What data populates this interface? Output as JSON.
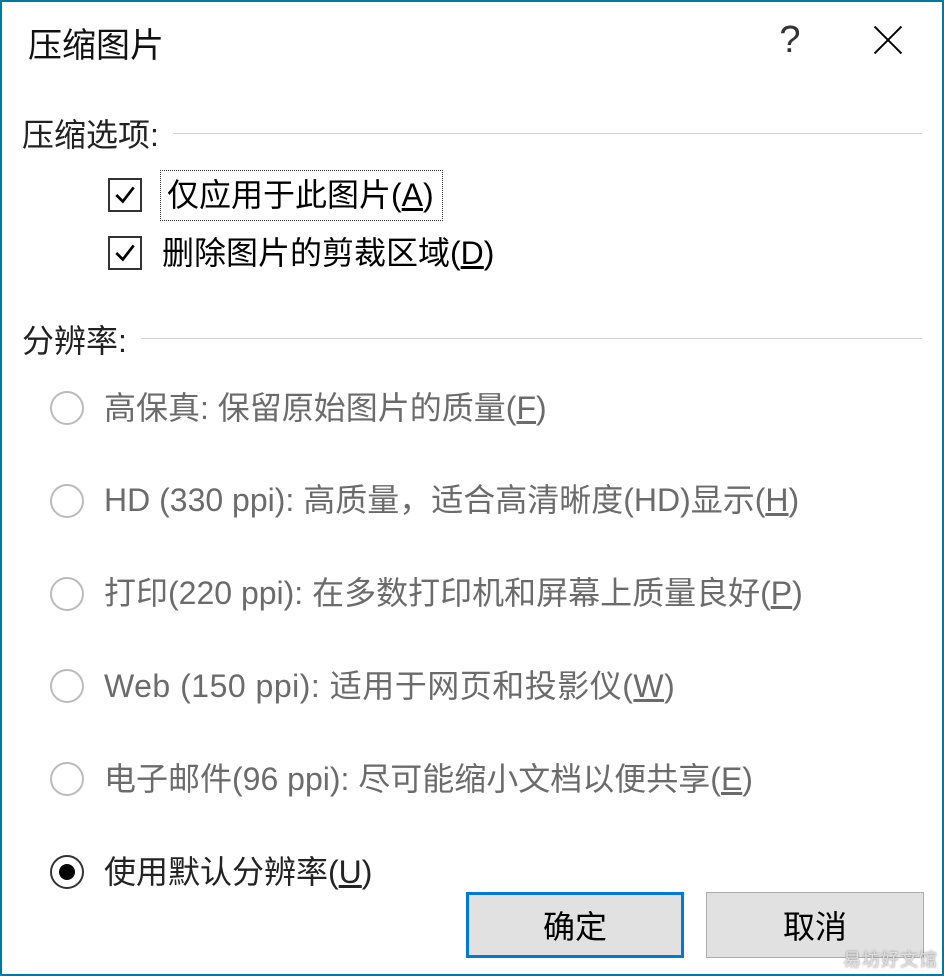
{
  "titlebar": {
    "title": "压缩图片",
    "help": "?"
  },
  "sections": {
    "compress": {
      "header": "压缩选项:",
      "opt_apply_only": {
        "pre": "仅应用于此图片(",
        "hotkey": "A",
        "post": ")"
      },
      "opt_delete_crop": {
        "pre": "删除图片的剪裁区域(",
        "hotkey": "D",
        "post": ")"
      }
    },
    "resolution": {
      "header": "分辨率:",
      "hifi": {
        "pre": "高保真: 保留原始图片的质量(",
        "hotkey": "F",
        "post": ")"
      },
      "hd": {
        "pre": "HD (330 ppi): 高质量，适合高清晰度(HD)显示(",
        "hotkey": "H",
        "post": ")"
      },
      "print": {
        "pre": "打印(220 ppi): 在多数打印机和屏幕上质量良好(",
        "hotkey": "P",
        "post": ")"
      },
      "web": {
        "pre": "Web (150 ppi): 适用于网页和投影仪(",
        "hotkey": "W",
        "post": ")"
      },
      "email": {
        "pre": "电子邮件(96 ppi): 尽可能缩小文档以便共享(",
        "hotkey": "E",
        "post": ")"
      },
      "default": {
        "pre": "使用默认分辨率(",
        "hotkey": "U",
        "post": ")"
      }
    }
  },
  "buttons": {
    "ok": "确定",
    "cancel": "取消"
  },
  "watermark": "易坊好文馆"
}
